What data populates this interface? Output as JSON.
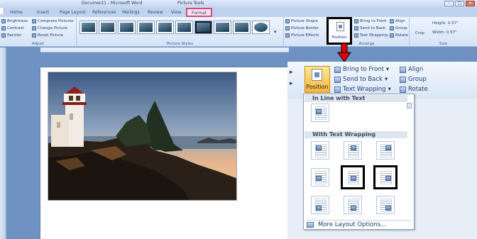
{
  "window": {
    "title": "Document1 - Microsoft Word",
    "contextual_tab": "Picture Tools",
    "buttons": {
      "minimize": "–",
      "maximize": "□",
      "close": "✕"
    }
  },
  "tabs": [
    "Home",
    "Insert",
    "Page Layout",
    "References",
    "Mailings",
    "Review",
    "View",
    "Format"
  ],
  "active_tab": "Format",
  "ribbon": {
    "adjust": {
      "items": [
        "Brightness",
        "Contrast",
        "Recolor",
        "Compress Pictures",
        "Change Picture",
        "Reset Picture"
      ],
      "label": "Adjust"
    },
    "picture_styles": {
      "label": "Picture Styles",
      "items": [
        "Picture Shape",
        "Picture Border",
        "Picture Effects"
      ]
    },
    "arrange": {
      "position": "Position",
      "items": [
        "Bring to Front",
        "Send to Back",
        "Text Wrapping",
        "Align",
        "Group",
        "Rotate"
      ],
      "label": "Arrange"
    },
    "size": {
      "crop": "Crop",
      "height_label": "Height:",
      "height": "0.57\"",
      "width_label": "Width:",
      "width": "0.57\"",
      "label": "Size"
    }
  },
  "panel": {
    "position": "Position",
    "bring_to_front": "Bring to Front",
    "send_to_back": "Send to Back",
    "text_wrapping": "Text Wrapping",
    "align": "Align",
    "group": "Group",
    "rotate": "Rotate",
    "dropdown": {
      "section_inline": "In Line with Text",
      "section_wrapping": "With Text Wrapping",
      "more": "More Layout Options..."
    }
  },
  "accent_colors": {
    "highlight": "#cf4e7d",
    "arrow": "#e00000",
    "ribbon": "#d5e3f6"
  }
}
